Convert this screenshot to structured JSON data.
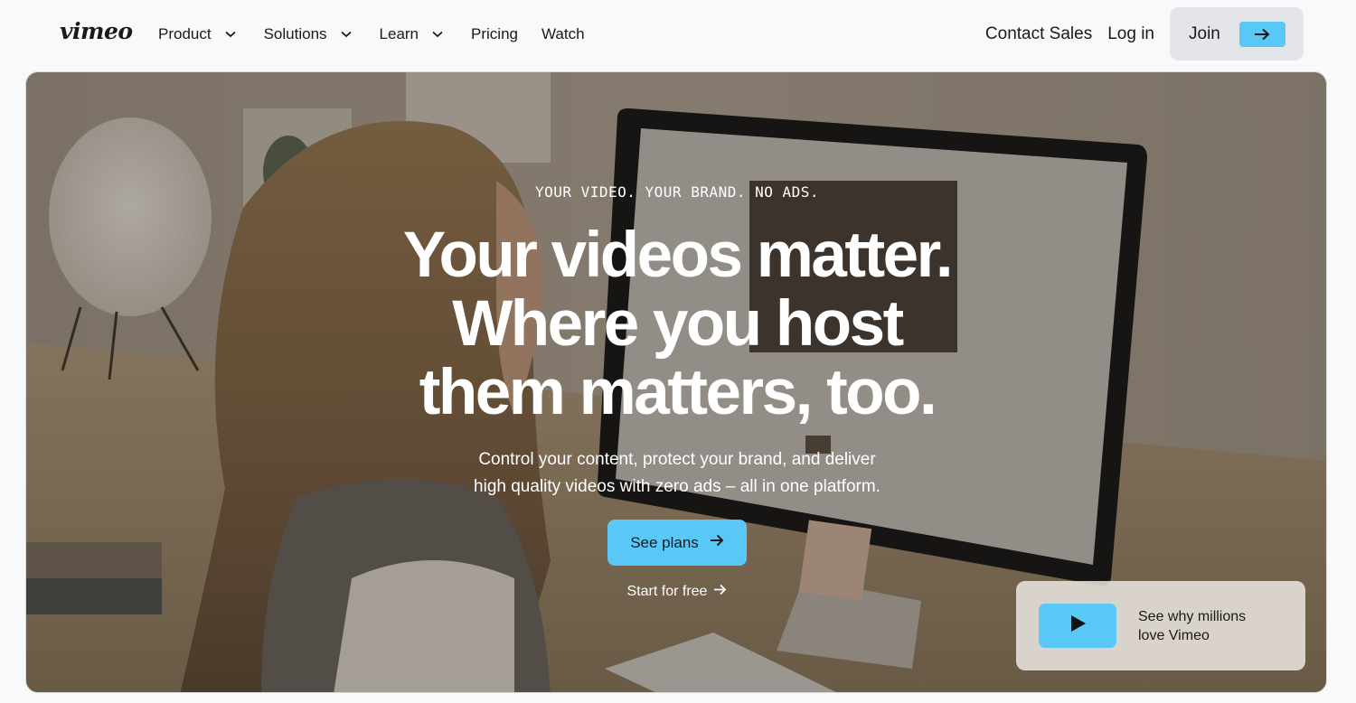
{
  "brand": {
    "logo_text": "vimeo"
  },
  "nav": {
    "items": [
      {
        "label": "Product",
        "has_dropdown": true
      },
      {
        "label": "Solutions",
        "has_dropdown": true
      },
      {
        "label": "Learn",
        "has_dropdown": true
      },
      {
        "label": "Pricing",
        "has_dropdown": false
      },
      {
        "label": "Watch",
        "has_dropdown": false
      }
    ],
    "contact_sales": "Contact Sales",
    "login": "Log in",
    "join": "Join"
  },
  "hero": {
    "eyebrow": "YOUR VIDEO. YOUR BRAND. NO ADS.",
    "headline_lines": [
      "Your videos matter.",
      "Where you host",
      "them matters, too."
    ],
    "subtitle_lines": [
      "Control your content, protect your brand, and deliver",
      "high quality videos with zero ads – all in one platform."
    ],
    "primary_cta": "See plans",
    "secondary_cta": "Start for free",
    "video_card_lines": [
      "See why millions",
      "love Vimeo"
    ]
  },
  "colors": {
    "accent": "#59c8f7",
    "text": "#1a1a1a",
    "page_bg": "#f8f9fb",
    "join_bg": "#e3e5e9"
  },
  "icons": [
    "chevron-down-icon",
    "arrow-right-icon",
    "play-icon"
  ]
}
